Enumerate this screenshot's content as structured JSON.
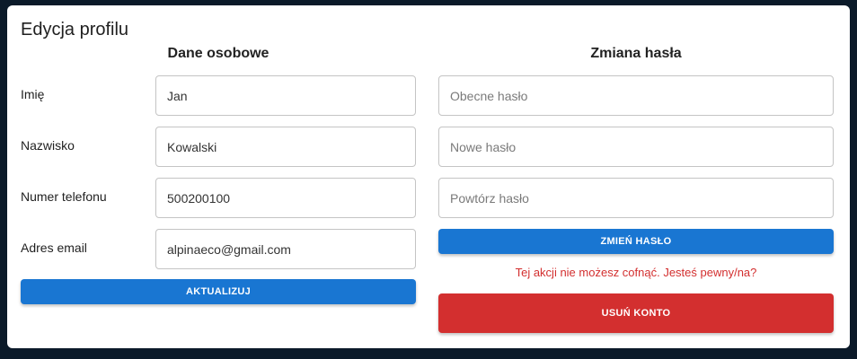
{
  "card": {
    "title": "Edycja profilu"
  },
  "personal": {
    "heading": "Dane osobowe",
    "fields": [
      {
        "label": "Imię",
        "value": "Jan"
      },
      {
        "label": "Nazwisko",
        "value": "Kowalski"
      },
      {
        "label": "Numer telefonu",
        "value": "500200100"
      },
      {
        "label": "Adres email",
        "value": "alpinaeco@gmail.com"
      }
    ],
    "submit_label": "AKTUALIZUJ"
  },
  "password": {
    "heading": "Zmiana hasła",
    "current_placeholder": "Obecne hasło",
    "new_placeholder": "Nowe hasło",
    "repeat_placeholder": "Powtórz hasło",
    "submit_label": "ZMIEŃ HASŁO"
  },
  "danger": {
    "warning": "Tej akcji nie możesz cofnąć. Jesteś pewny/na?",
    "delete_label": "USUŃ KONTO"
  },
  "colors": {
    "background": "#0b1a29",
    "primary": "#1976d2",
    "danger": "#d32f2f"
  }
}
